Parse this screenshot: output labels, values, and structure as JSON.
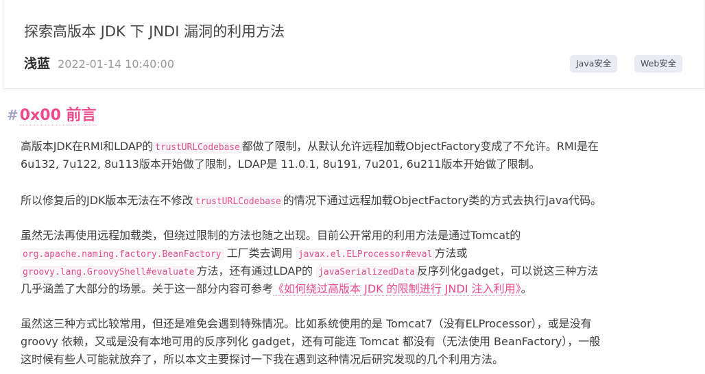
{
  "post": {
    "title": "探索高版本 JDK 下 JNDI 漏洞的利用方法",
    "author": "浅蓝",
    "date": "2022-01-14 10:40:00",
    "tags": [
      "Java安全",
      "Web安全"
    ]
  },
  "section": {
    "hash": "#",
    "heading": "0x00 前言"
  },
  "paragraphs": {
    "p1": {
      "l1_a": "高版本JDK在RMI和LDAP的",
      "l1_code": "trustURLCodebase",
      "l1_b": "都做了限制，从默认允许远程加载ObjectFactory变成了不允许。RMI是在",
      "l2": "6u132, 7u122, 8u113版本开始做了限制，LDAP是 11.0.1, 8u191, 7u201, 6u211版本开始做了限制。"
    },
    "p2": {
      "l1_a": "所以修复后的JDK版本无法在不修改",
      "l1_code": "trustURLCodebase",
      "l1_b": "的情况下通过远程加载ObjectFactory类的方式去执行Java代码。"
    },
    "p3": {
      "l1": "虽然无法再使用远程加载类，但绕过限制的方法也随之出现。目前公开常用的利用方法是通过Tomcat的",
      "l2_code1": "org.apache.naming.factory.BeanFactory",
      "l2_a": " 工厂类去调用 ",
      "l2_code2": "javax.el.ELProcessor#eval",
      "l2_b": "方法或",
      "l3_code1": "groovy.lang.GroovyShell#evaluate",
      "l3_a": "方法，还有通过LDAP的 ",
      "l3_code2": "javaSerializedData",
      "l3_b": "反序列化gadget，可以说这三种方法",
      "l4_a": "几乎涵盖了大部分的场景。关于这一部分内容可参考",
      "l4_link": "《如何绕过高版本 JDK 的限制进行 JNDI 注入利用》",
      "l4_b": "。"
    },
    "p4": {
      "l1": "虽然这三种方式比较常用，但还是难免会遇到特殊情况。比如系统使用的是 Tomcat7（没有ELProcessor），或是没有",
      "l2": "groovy 依赖，又或是没有本地可用的反序列化 gadget，还有可能连 Tomcat 都没有（无法使用 BeanFactory），一般",
      "l3": "这时候有些人可能就放弃了，所以本文主要探讨一下我在遇到这种情况后研究发现的几个利用方法。"
    }
  }
}
